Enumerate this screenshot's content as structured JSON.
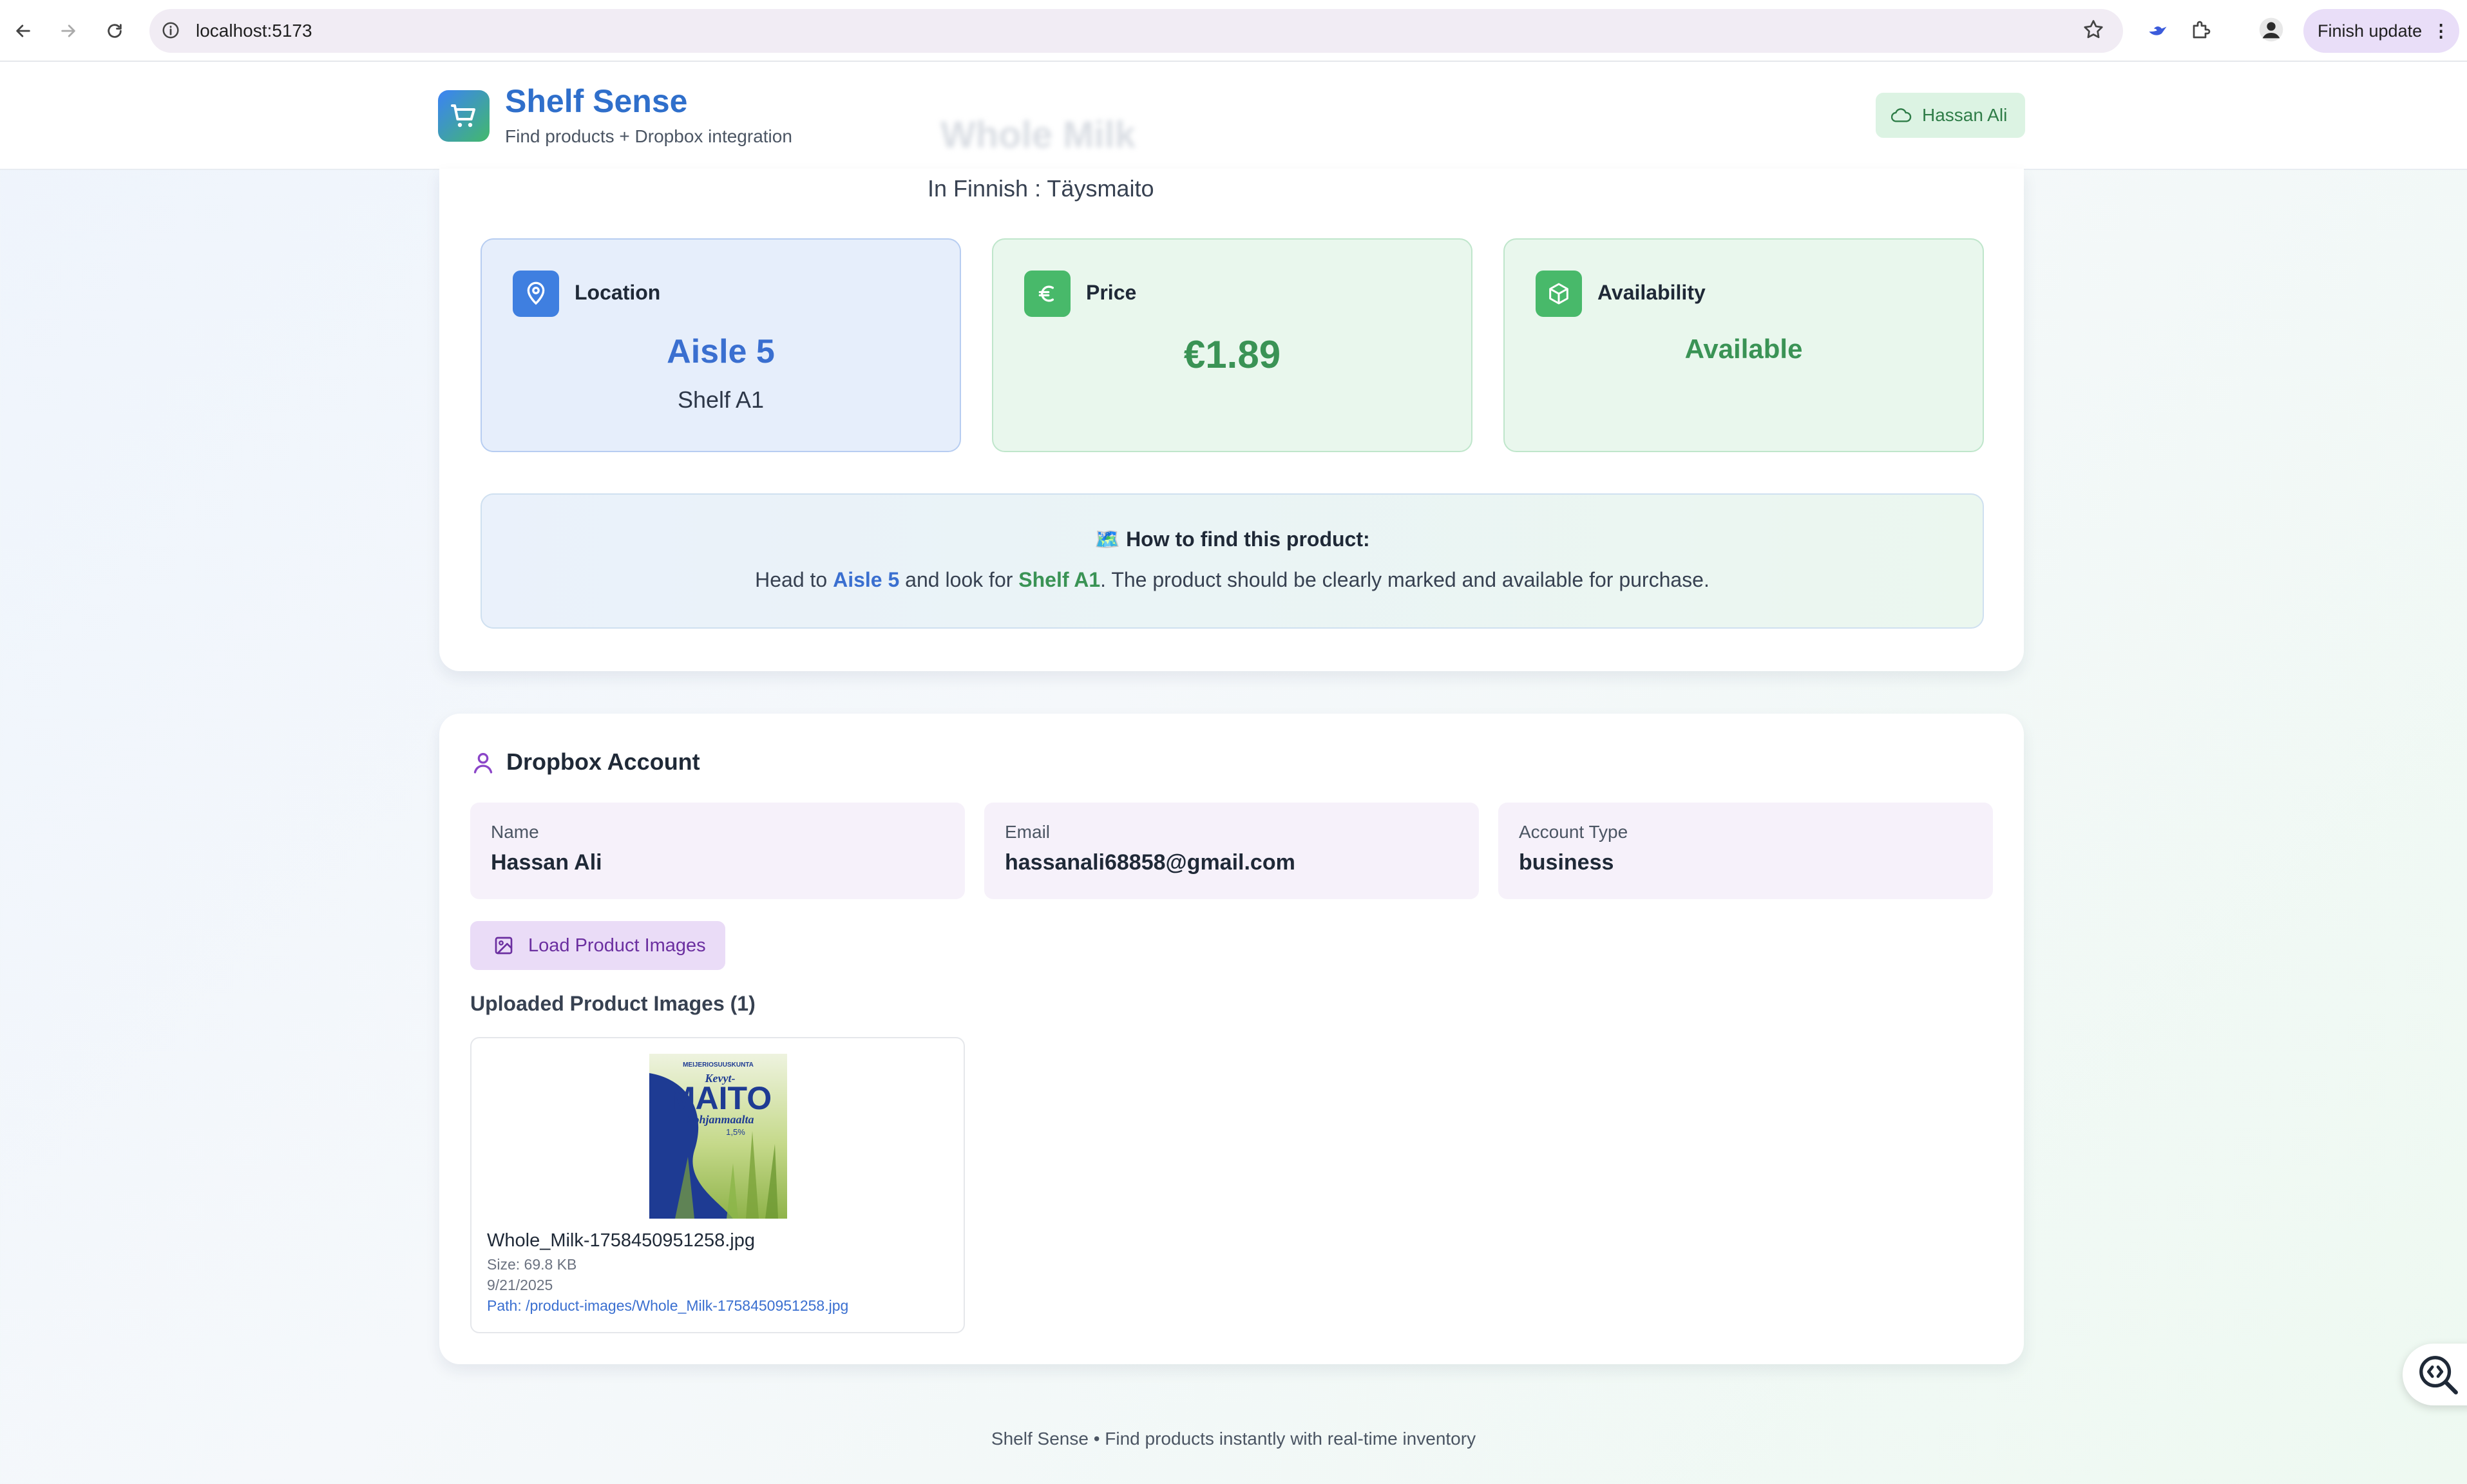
{
  "browser": {
    "url": "localhost:5173",
    "finish_update_label": "Finish update"
  },
  "header": {
    "brand_title": "Shelf Sense",
    "brand_subtitle": "Find products + Dropbox integration",
    "user_name": "Hassan Ali",
    "obscured_product_title": "Whole Milk"
  },
  "product": {
    "finnish_name": "In Finnish : Täysmaito",
    "location": {
      "label": "Location",
      "aisle": "Aisle 5",
      "shelf": "Shelf A1"
    },
    "price": {
      "label": "Price",
      "value": "€1.89"
    },
    "availability": {
      "label": "Availability",
      "value": "Available"
    },
    "howto": {
      "title": "🗺️ How to find this product:",
      "text_before": "Head to ",
      "aisle": "Aisle 5",
      "text_mid": " and look for ",
      "shelf": "Shelf A1",
      "text_after": ". The product should be clearly marked and available for purchase."
    }
  },
  "dropbox": {
    "title": "Dropbox Account",
    "fields": [
      {
        "label": "Name",
        "value": "Hassan Ali"
      },
      {
        "label": "Email",
        "value": "hassanali68858@gmail.com"
      },
      {
        "label": "Account Type",
        "value": "business"
      }
    ],
    "load_button_label": "Load Product Images",
    "uploaded_title": "Uploaded Product Images (1)",
    "images": [
      {
        "filename": "Whole_Milk-1758450951258.jpg",
        "size": "Size: 69.8 KB",
        "date": "9/21/2025",
        "path": "Path: /product-images/Whole_Milk-1758450951258.jpg",
        "brand": "MAITO",
        "brand_top": "MEIJERIOSUUSKUNTA",
        "brand_kevyt": "Kevyt-",
        "brand_sub": "Pohjanmaalta",
        "fat": "1,5%"
      }
    ]
  },
  "footer": {
    "text": "Shelf Sense • Find products instantly with real-time inventory"
  },
  "colors": {
    "brand_blue": "#2f6fcb",
    "accent_green": "#3a9355",
    "dropbox_purple": "#6b2fa0"
  }
}
